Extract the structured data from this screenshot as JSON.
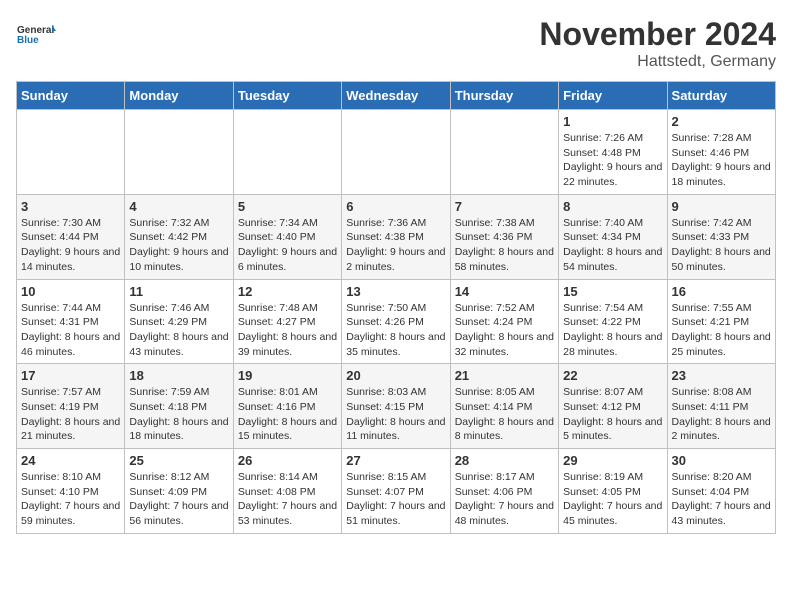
{
  "logo": {
    "general": "General",
    "blue": "Blue"
  },
  "title": "November 2024",
  "location": "Hattstedt, Germany",
  "headers": [
    "Sunday",
    "Monday",
    "Tuesday",
    "Wednesday",
    "Thursday",
    "Friday",
    "Saturday"
  ],
  "weeks": [
    [
      {
        "day": "",
        "info": ""
      },
      {
        "day": "",
        "info": ""
      },
      {
        "day": "",
        "info": ""
      },
      {
        "day": "",
        "info": ""
      },
      {
        "day": "",
        "info": ""
      },
      {
        "day": "1",
        "info": "Sunrise: 7:26 AM\nSunset: 4:48 PM\nDaylight: 9 hours and 22 minutes."
      },
      {
        "day": "2",
        "info": "Sunrise: 7:28 AM\nSunset: 4:46 PM\nDaylight: 9 hours and 18 minutes."
      }
    ],
    [
      {
        "day": "3",
        "info": "Sunrise: 7:30 AM\nSunset: 4:44 PM\nDaylight: 9 hours and 14 minutes."
      },
      {
        "day": "4",
        "info": "Sunrise: 7:32 AM\nSunset: 4:42 PM\nDaylight: 9 hours and 10 minutes."
      },
      {
        "day": "5",
        "info": "Sunrise: 7:34 AM\nSunset: 4:40 PM\nDaylight: 9 hours and 6 minutes."
      },
      {
        "day": "6",
        "info": "Sunrise: 7:36 AM\nSunset: 4:38 PM\nDaylight: 9 hours and 2 minutes."
      },
      {
        "day": "7",
        "info": "Sunrise: 7:38 AM\nSunset: 4:36 PM\nDaylight: 8 hours and 58 minutes."
      },
      {
        "day": "8",
        "info": "Sunrise: 7:40 AM\nSunset: 4:34 PM\nDaylight: 8 hours and 54 minutes."
      },
      {
        "day": "9",
        "info": "Sunrise: 7:42 AM\nSunset: 4:33 PM\nDaylight: 8 hours and 50 minutes."
      }
    ],
    [
      {
        "day": "10",
        "info": "Sunrise: 7:44 AM\nSunset: 4:31 PM\nDaylight: 8 hours and 46 minutes."
      },
      {
        "day": "11",
        "info": "Sunrise: 7:46 AM\nSunset: 4:29 PM\nDaylight: 8 hours and 43 minutes."
      },
      {
        "day": "12",
        "info": "Sunrise: 7:48 AM\nSunset: 4:27 PM\nDaylight: 8 hours and 39 minutes."
      },
      {
        "day": "13",
        "info": "Sunrise: 7:50 AM\nSunset: 4:26 PM\nDaylight: 8 hours and 35 minutes."
      },
      {
        "day": "14",
        "info": "Sunrise: 7:52 AM\nSunset: 4:24 PM\nDaylight: 8 hours and 32 minutes."
      },
      {
        "day": "15",
        "info": "Sunrise: 7:54 AM\nSunset: 4:22 PM\nDaylight: 8 hours and 28 minutes."
      },
      {
        "day": "16",
        "info": "Sunrise: 7:55 AM\nSunset: 4:21 PM\nDaylight: 8 hours and 25 minutes."
      }
    ],
    [
      {
        "day": "17",
        "info": "Sunrise: 7:57 AM\nSunset: 4:19 PM\nDaylight: 8 hours and 21 minutes."
      },
      {
        "day": "18",
        "info": "Sunrise: 7:59 AM\nSunset: 4:18 PM\nDaylight: 8 hours and 18 minutes."
      },
      {
        "day": "19",
        "info": "Sunrise: 8:01 AM\nSunset: 4:16 PM\nDaylight: 8 hours and 15 minutes."
      },
      {
        "day": "20",
        "info": "Sunrise: 8:03 AM\nSunset: 4:15 PM\nDaylight: 8 hours and 11 minutes."
      },
      {
        "day": "21",
        "info": "Sunrise: 8:05 AM\nSunset: 4:14 PM\nDaylight: 8 hours and 8 minutes."
      },
      {
        "day": "22",
        "info": "Sunrise: 8:07 AM\nSunset: 4:12 PM\nDaylight: 8 hours and 5 minutes."
      },
      {
        "day": "23",
        "info": "Sunrise: 8:08 AM\nSunset: 4:11 PM\nDaylight: 8 hours and 2 minutes."
      }
    ],
    [
      {
        "day": "24",
        "info": "Sunrise: 8:10 AM\nSunset: 4:10 PM\nDaylight: 7 hours and 59 minutes."
      },
      {
        "day": "25",
        "info": "Sunrise: 8:12 AM\nSunset: 4:09 PM\nDaylight: 7 hours and 56 minutes."
      },
      {
        "day": "26",
        "info": "Sunrise: 8:14 AM\nSunset: 4:08 PM\nDaylight: 7 hours and 53 minutes."
      },
      {
        "day": "27",
        "info": "Sunrise: 8:15 AM\nSunset: 4:07 PM\nDaylight: 7 hours and 51 minutes."
      },
      {
        "day": "28",
        "info": "Sunrise: 8:17 AM\nSunset: 4:06 PM\nDaylight: 7 hours and 48 minutes."
      },
      {
        "day": "29",
        "info": "Sunrise: 8:19 AM\nSunset: 4:05 PM\nDaylight: 7 hours and 45 minutes."
      },
      {
        "day": "30",
        "info": "Sunrise: 8:20 AM\nSunset: 4:04 PM\nDaylight: 7 hours and 43 minutes."
      }
    ]
  ]
}
